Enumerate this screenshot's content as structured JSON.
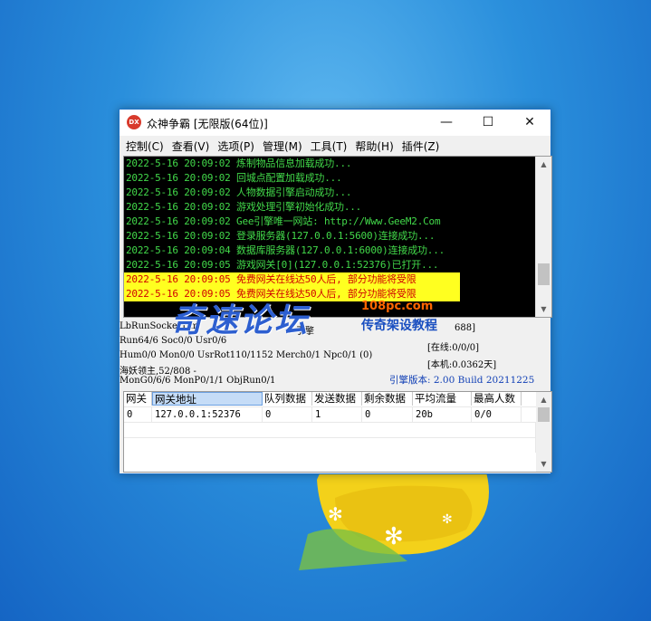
{
  "window": {
    "title": "众神争霸 [无限版(64位)]",
    "icon_text": "DX",
    "controls": {
      "minimize": "—",
      "maximize": "☐",
      "close": "✕"
    }
  },
  "menu": [
    "控制(C)",
    "查看(V)",
    "选项(P)",
    "管理(M)",
    "工具(T)",
    "帮助(H)",
    "插件(Z)"
  ],
  "log": [
    {
      "text": "2022-5-16 20:09:02 炼制物品信息加载成功...",
      "warn": false
    },
    {
      "text": "2022-5-16 20:09:02 回城点配置加载成功...",
      "warn": false
    },
    {
      "text": "2022-5-16 20:09:02 人物数据引擎启动成功...",
      "warn": false
    },
    {
      "text": "2022-5-16 20:09:02 游戏处理引擎初始化成功...",
      "warn": false
    },
    {
      "text": "2022-5-16 20:09:02 Gee引擎唯一网站: http://Www.GeeM2.Com",
      "warn": false
    },
    {
      "text": "2022-5-16 20:09:02 登录服务器(127.0.0.1:5600)连接成功...",
      "warn": false
    },
    {
      "text": "2022-5-16 20:09:04 数据库服务器(127.0.0.1:6000)连接成功...",
      "warn": false
    },
    {
      "text": "2022-5-16 20:09:05 游戏网关[0](127.0.0.1:52376)已打开...",
      "warn": false
    },
    {
      "text": "2022-5-16 20:09:05 免费网关在线达50人后, 部分功能将受限",
      "warn": true
    },
    {
      "text": "2022-5-16 20:09:05 免费网关在线达50人后, 部分功能将受限",
      "warn": true
    }
  ],
  "status": {
    "lbrun": "LbRunSocketTim",
    "count_label": "引擎",
    "count_value": "688]",
    "run": "Run64/6 Soc0/0 Usr0/6",
    "online": "[在线:0/0/0]",
    "hum": "Hum0/0 Mon0/0 UsrRot110/1152 Merch0/1 Npc0/1 (0)",
    "local": "[本机:0.0362天]",
    "boss": "海妖领主,52/808 -",
    "mongen": "MonG0/6/6 MonP0/1/1 ObjRun0/1",
    "version": "引擎版本: 2.00 Build 20211225"
  },
  "watermark": {
    "title": "奇速论坛",
    "url": "108pc.com",
    "sub": "传奇架设教程"
  },
  "table": {
    "headers": [
      "网关",
      "网关地址",
      "队列数据",
      "发送数据",
      "剩余数据",
      "平均流量",
      "最高人数"
    ],
    "rows": [
      [
        "0",
        "127.0.0.1:52376",
        "0",
        "1",
        "0",
        "20b",
        "0/0"
      ]
    ]
  },
  "colors": {
    "log_text": "#42d94a",
    "warn_bg": "#ffff20",
    "warn_text": "#d00000",
    "version_text": "#0f3eb5"
  },
  "log_scroll_fraction": 0.85
}
